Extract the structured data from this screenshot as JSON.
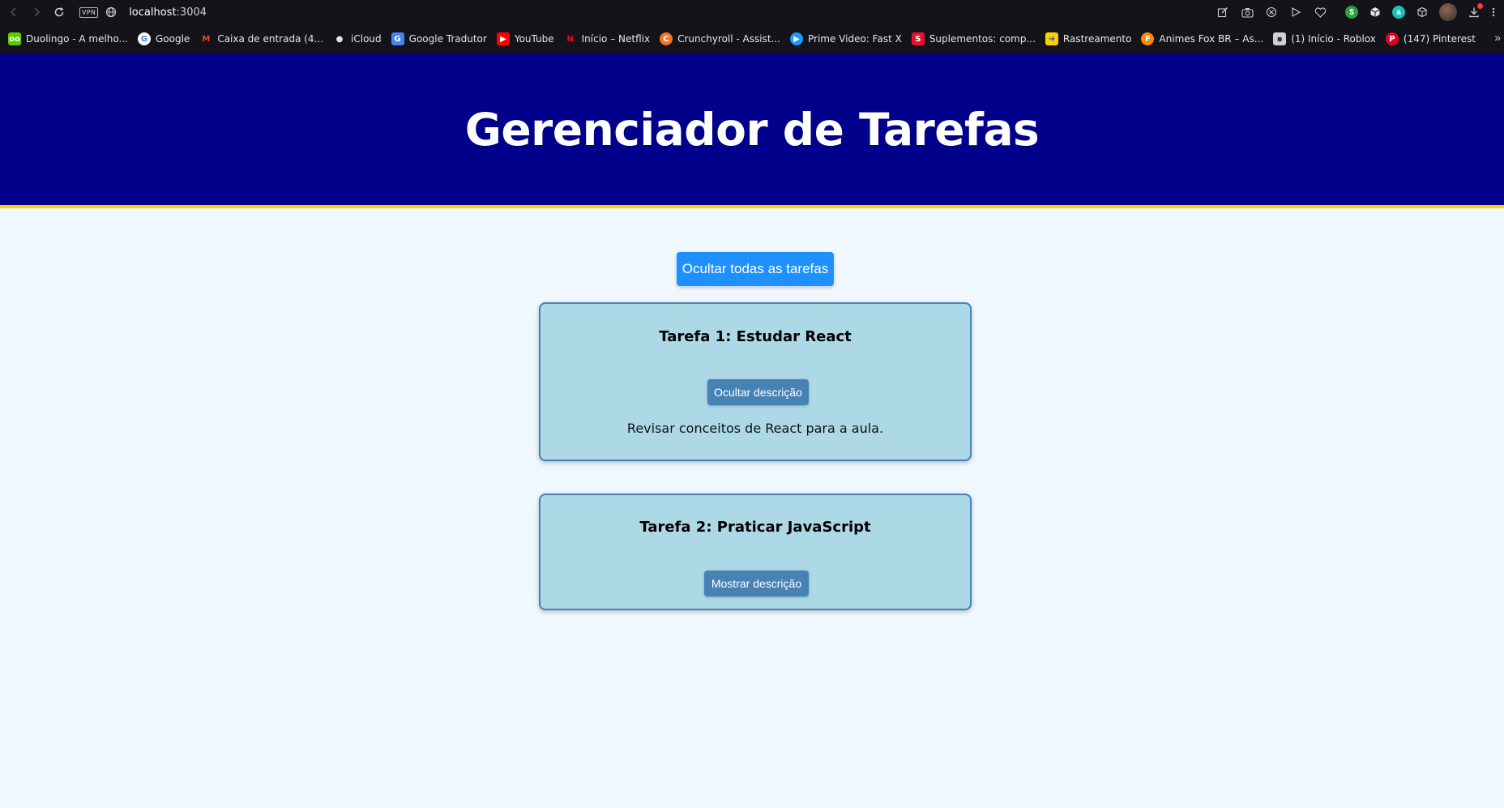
{
  "browser": {
    "url_host": "localhost",
    "url_port": ":3004",
    "vpn_label": "VPN",
    "bookmarks": [
      {
        "label": "Duolingo - A melho...",
        "icon": "duolingo-icon",
        "color": "#58cc02",
        "glyph": "oo"
      },
      {
        "label": "Google",
        "icon": "google-icon",
        "color": "#ffffff",
        "glyph": "G"
      },
      {
        "label": "Caixa de entrada (4...",
        "icon": "gmail-icon",
        "color": "#14131a",
        "glyph": "M"
      },
      {
        "label": "iCloud",
        "icon": "apple-icon",
        "color": "#14131a",
        "glyph": ""
      },
      {
        "label": "Google Tradutor",
        "icon": "google-translate-icon",
        "color": "#4285f4",
        "glyph": "G"
      },
      {
        "label": "YouTube",
        "icon": "youtube-icon",
        "color": "#ff0000",
        "glyph": "▶"
      },
      {
        "label": "Início – Netflix",
        "icon": "netflix-icon",
        "color": "#14131a",
        "glyph": "N"
      },
      {
        "label": "Crunchyroll - Assist...",
        "icon": "crunchyroll-icon",
        "color": "#f47521",
        "glyph": "C"
      },
      {
        "label": "Prime Video: Fast X",
        "icon": "prime-video-icon",
        "color": "#1a98ff",
        "glyph": "▶"
      },
      {
        "label": "Suplementos: comp...",
        "icon": "supplements-icon",
        "color": "#e8112d",
        "glyph": "S"
      },
      {
        "label": "Rastreamento",
        "icon": "tracking-icon",
        "color": "#ffcc00",
        "glyph": "➜"
      },
      {
        "label": "Animes Fox BR – As...",
        "icon": "animes-fox-icon",
        "color": "#ff8a00",
        "glyph": "F"
      },
      {
        "label": "(1) Início - Roblox",
        "icon": "roblox-icon",
        "color": "#d0d0d0",
        "glyph": "▪"
      },
      {
        "label": "(147) Pinterest",
        "icon": "pinterest-icon",
        "color": "#e60023",
        "glyph": "P"
      }
    ]
  },
  "app": {
    "title": "Gerenciador de Tarefas",
    "toggle_all_label": "Ocultar todas as tarefas",
    "tasks": [
      {
        "title": "Tarefa 1: Estudar React",
        "button_label": "Ocultar descrição",
        "description": "Revisar conceitos de React para a aula."
      },
      {
        "title": "Tarefa 2: Praticar JavaScript",
        "button_label": "Mostrar descrição"
      }
    ]
  },
  "colors": {
    "header_bg": "#00008b",
    "header_border": "#ffd700",
    "page_bg": "#f0f8ff",
    "primary_button": "#1e90ff",
    "card_bg": "#add8e6",
    "card_border": "#4682b4"
  }
}
